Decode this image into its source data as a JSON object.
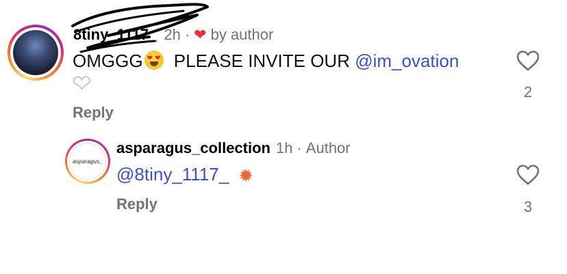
{
  "comment": {
    "username": "8tiny_1117_",
    "time": "2h",
    "separator": "·",
    "liked_by_author": "by author",
    "text_before": "OMGGG",
    "text_middle": "PLEASE INVITE OUR",
    "mention": "@im_ovation",
    "reply_label": "Reply",
    "like_count": "2"
  },
  "reply_comment": {
    "username": "asparagus_collection",
    "time": "1h",
    "separator": "·",
    "author_badge": "Author",
    "mention": "@8tiny_1117_",
    "avatar_text": "asparagus_",
    "reply_label": "Reply",
    "like_count": "3"
  },
  "colors": {
    "mention": "#3b4fd4",
    "meta": "#737373",
    "heart_red": "#ed2f3b"
  },
  "icons": {
    "heart_outline": "heart-outline-icon",
    "heart_red": "red-heart-icon",
    "heart_white": "white-heart-emoji",
    "heart_eyes": "heart-eyes-emoji",
    "collision": "collision-emoji"
  }
}
